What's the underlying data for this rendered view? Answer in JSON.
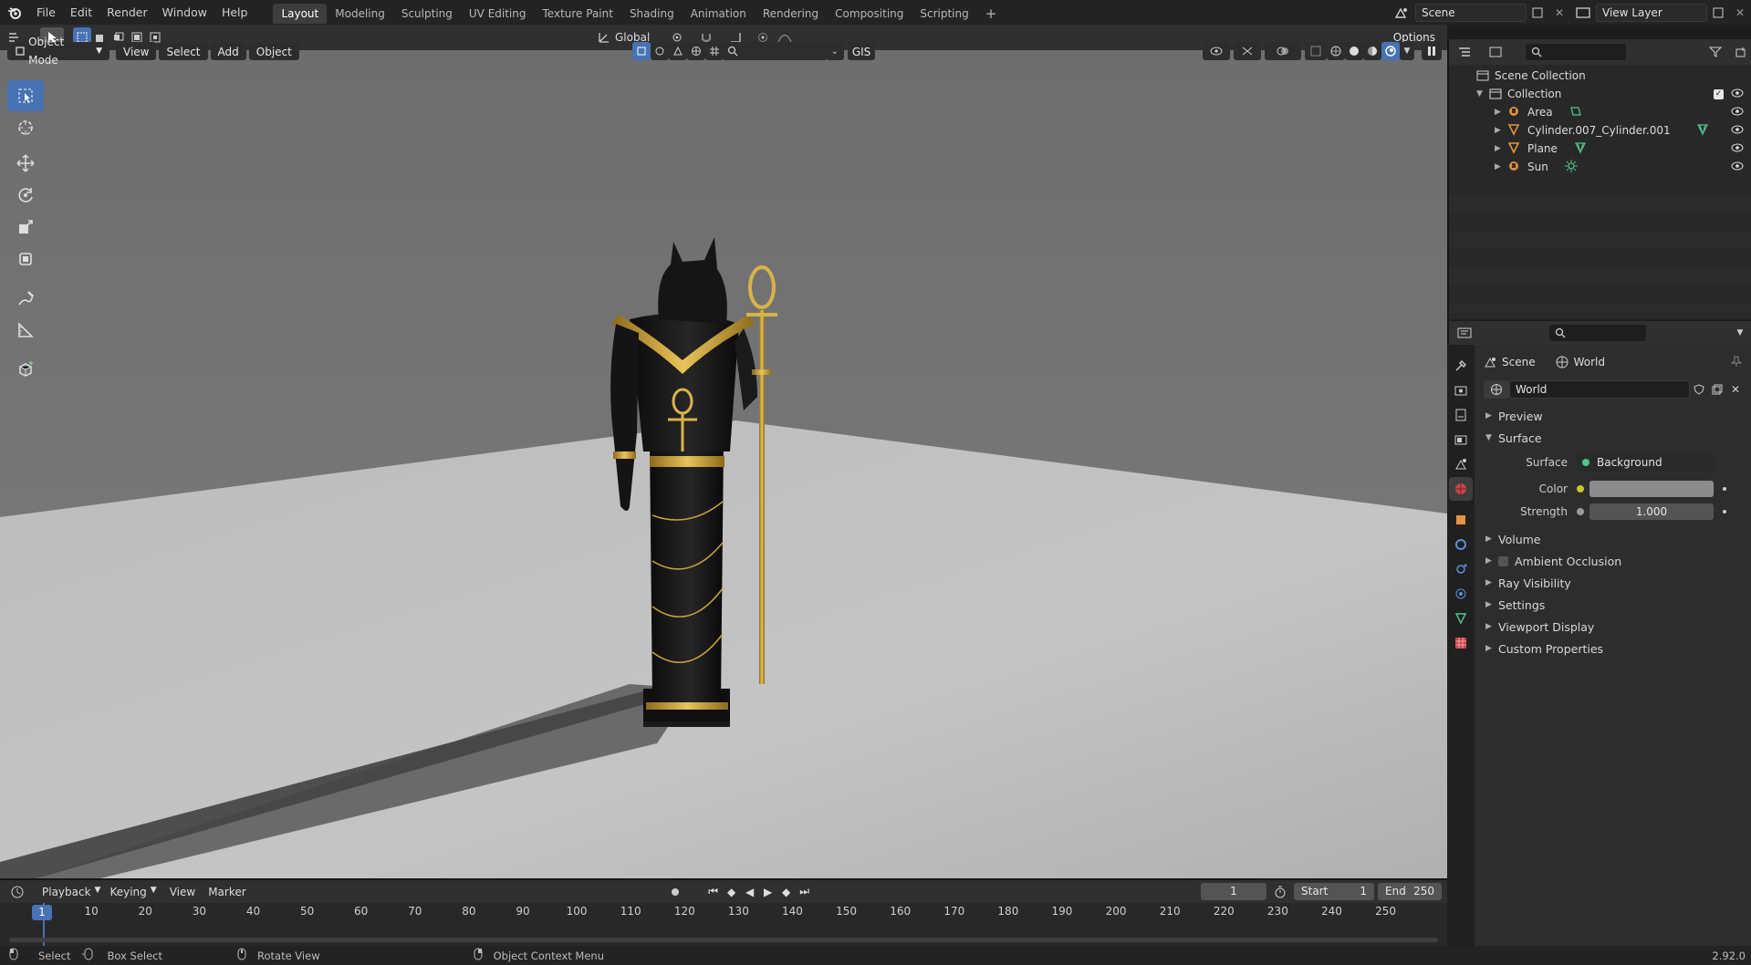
{
  "menu": {
    "items": [
      "File",
      "Edit",
      "Render",
      "Window",
      "Help"
    ]
  },
  "workspaces": [
    "Layout",
    "Modeling",
    "Sculpting",
    "UV Editing",
    "Texture Paint",
    "Shading",
    "Animation",
    "Rendering",
    "Compositing",
    "Scripting"
  ],
  "active_workspace": "Layout",
  "scene_field": "Scene",
  "view_layer_field": "View Layer",
  "header2": {
    "orientation": "Global",
    "options": "Options"
  },
  "viewport_header": {
    "mode": "Object Mode",
    "view": "View",
    "select": "Select",
    "add": "Add",
    "object": "Object",
    "gis": "GIS"
  },
  "outliner": {
    "root": "Scene Collection",
    "collection": "Collection",
    "items": [
      {
        "name": "Area",
        "type_icon": "light-icon",
        "extra_icon": "light-data-icon"
      },
      {
        "name": "Cylinder.007_Cylinder.001",
        "type_icon": "mesh-icon",
        "extra_icon": "mesh-data-icon"
      },
      {
        "name": "Plane",
        "type_icon": "mesh-icon",
        "extra_icon": "mesh-data-icon"
      },
      {
        "name": "Sun",
        "type_icon": "light-icon",
        "extra_icon": "sun-data-icon"
      }
    ]
  },
  "properties": {
    "breadcrumb_scene": "Scene",
    "breadcrumb_world": "World",
    "world_name": "World",
    "panels": {
      "preview": "Preview",
      "surface": "Surface",
      "volume": "Volume",
      "ambient_occlusion": "Ambient Occlusion",
      "ray_visibility": "Ray Visibility",
      "settings": "Settings",
      "viewport_display": "Viewport Display",
      "custom_properties": "Custom Properties"
    },
    "surface_label": "Surface",
    "surface_value": "Background",
    "color_label": "Color",
    "strength_label": "Strength",
    "strength_value": "1.000"
  },
  "timeline": {
    "playback": "Playback",
    "keying": "Keying",
    "view": "View",
    "marker": "Marker",
    "current_frame": "1",
    "start_label": "Start",
    "start_value": "1",
    "end_label": "End",
    "end_value": "250",
    "ticks": [
      "1",
      "10",
      "20",
      "30",
      "40",
      "50",
      "60",
      "70",
      "80",
      "90",
      "100",
      "110",
      "120",
      "130",
      "140",
      "150",
      "160",
      "170",
      "180",
      "190",
      "200",
      "210",
      "220",
      "230",
      "240",
      "250"
    ]
  },
  "status": {
    "select": "Select",
    "box_select": "Box Select",
    "rotate_view": "Rotate View",
    "context_menu": "Object Context Menu",
    "version": "2.92.0"
  },
  "colors": {
    "accent": "#4772b3",
    "gold": "#c9a23c",
    "statue_black": "#141414"
  }
}
